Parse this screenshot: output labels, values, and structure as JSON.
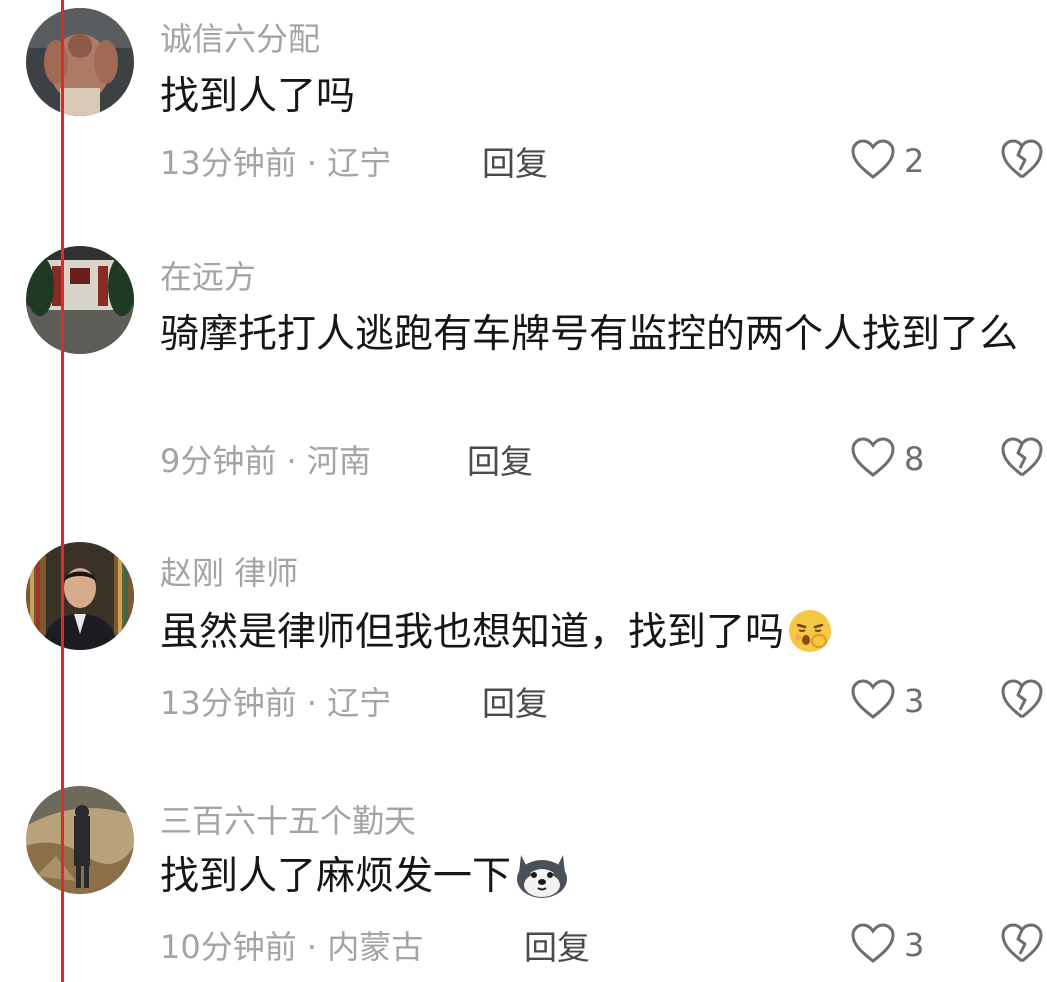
{
  "comments": [
    {
      "username": "诚信六分配",
      "text": "找到人了吗",
      "meta": "13分钟前 · 辽宁",
      "reply": "回复",
      "likes": "2"
    },
    {
      "username": "在远方",
      "text": "骑摩托打人逃跑有车牌号有监控的两个人找到了么",
      "meta": "9分钟前 · 河南",
      "reply": "回复",
      "likes": "8"
    },
    {
      "username": "赵刚 律师",
      "text": "虽然是律师但我也想知道，找到了吗",
      "meta": "13分钟前 · 辽宁",
      "reply": "回复",
      "likes": "3"
    },
    {
      "username": "三百六十五个勤天",
      "text": "找到人了麻烦发一下",
      "meta": "10分钟前 · 内蒙古",
      "reply": "回复",
      "likes": "3"
    }
  ],
  "icons": {
    "like": "heart-outline-icon",
    "dislike": "broken-heart-icon"
  },
  "colors": {
    "username": "#a3a3a8",
    "text": "#161616",
    "meta": "#a3a3a8",
    "marker_line": "#e02a2a"
  }
}
